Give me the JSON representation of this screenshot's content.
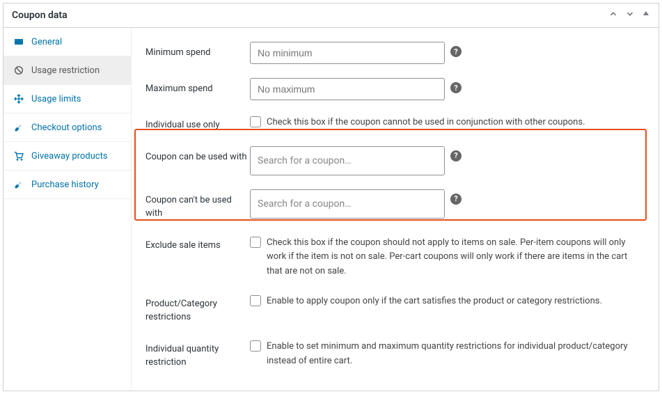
{
  "panel": {
    "title": "Coupon data"
  },
  "sidebar": {
    "items": [
      {
        "label": "General"
      },
      {
        "label": "Usage restriction"
      },
      {
        "label": "Usage limits"
      },
      {
        "label": "Checkout options"
      },
      {
        "label": "Giveaway products"
      },
      {
        "label": "Purchase history"
      }
    ]
  },
  "fields": {
    "min_spend": {
      "label": "Minimum spend",
      "placeholder": "No minimum"
    },
    "max_spend": {
      "label": "Maximum spend",
      "placeholder": "No maximum"
    },
    "individual_use": {
      "label": "Individual use only",
      "desc": "Check this box if the coupon cannot be used in conjunction with other coupons."
    },
    "used_with": {
      "label": "Coupon can be used with",
      "placeholder": "Search for a coupon…"
    },
    "not_used_with": {
      "label": "Coupon can't be used with",
      "placeholder": "Search for a coupon…"
    },
    "exclude_sale": {
      "label": "Exclude sale items",
      "desc": "Check this box if the coupon should not apply to items on sale. Per-item coupons will only work if the item is not on sale. Per-cart coupons will only work if there are items in the cart that are not on sale."
    },
    "prod_cat": {
      "label": "Product/Category restrictions",
      "desc": "Enable to apply coupon only if the cart satisfies the product or category restrictions."
    },
    "ind_qty": {
      "label": "Individual quantity restriction",
      "desc": "Enable to set minimum and maximum quantity restrictions for individual product/category instead of entire cart."
    }
  }
}
